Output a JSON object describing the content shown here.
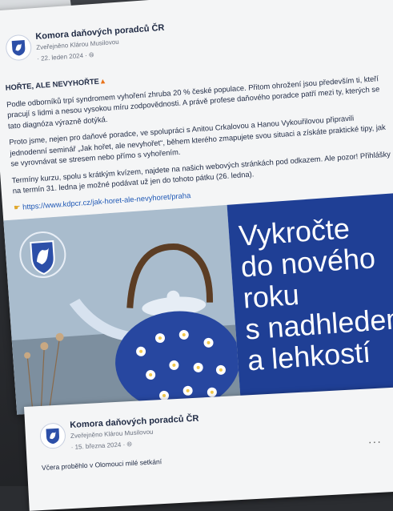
{
  "post1": {
    "org_name": "Komora daňových poradců ČR",
    "edited_by": "Zveřejněno Klárou Musilovou",
    "date": "· 22. leden 2024 · ",
    "more_label": "···",
    "headline": "HOŘTE, ALE NEVYHOŘTE",
    "paragraphs": [
      "Podle odborníků trpí syndromem vyhoření zhruba 20 % české populace. Přitom ohrožení jsou především ti, kteří pracují s lidmi a nesou vysokou míru zodpovědnosti. A právě profese daňového poradce patří mezi ty, kterých se tato diagnóza výrazně dotýká.",
      "Proto jsme, nejen pro daňové poradce, ve spolupráci s Anitou Crkalovou a Hanou Vykouřilovou připravili jednodenní seminář „Jak hořet, ale nevyhořet“, během kterého zmapujete svou situaci a získáte praktické tipy, jak se vyrovnávat se stresem nebo přímo s vyhořením.",
      "Termíny kurzu, spolu s krátkým kvízem, najdete na našich webových stránkách pod odkazem. Ale pozor! Přihlášky na termín 31. ledna je možné podávat už jen do tohoto pátku (26. ledna)."
    ],
    "link": "https://www.kdpcr.cz/jak-horet-ale-nevyhoret/praha",
    "promo_lines": [
      "Vykročte",
      "do nového",
      "roku",
      "s nadhledem",
      "a lehkostí"
    ]
  },
  "post2": {
    "org_name": "Komora daňových poradců ČR",
    "edited_by": "Zveřejněno Klárou Musilovou",
    "date": "· 15. března 2024 · ",
    "more_label": "···",
    "snippet": "Včera proběhlo v Olomouci milé setkání"
  },
  "colors": {
    "promo_bg": "#1f3f95",
    "link": "#1f58b5",
    "text": "#1f2a44"
  }
}
